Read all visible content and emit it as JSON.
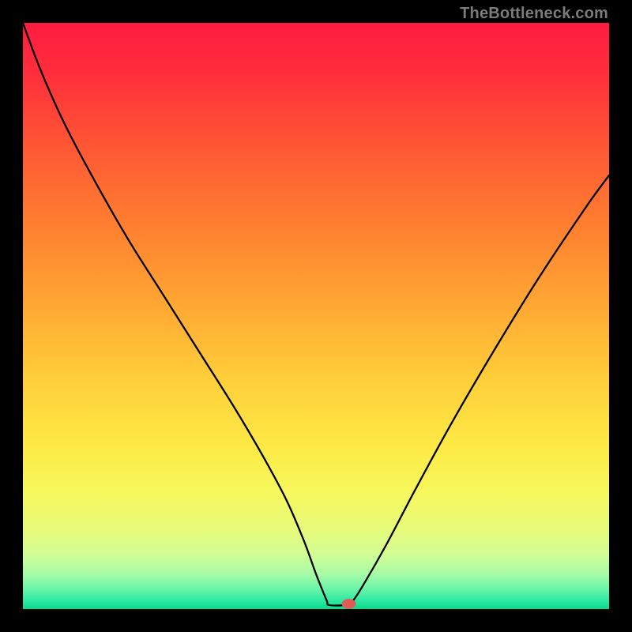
{
  "watermark": "TheBottleneck.com",
  "chart_data": {
    "type": "line",
    "title": "",
    "xlabel": "",
    "ylabel": "",
    "xlim": [
      0,
      100
    ],
    "ylim": [
      0,
      100
    ],
    "grid": false,
    "legend": false,
    "gradient_stops": [
      {
        "offset": 0.0,
        "color": "#ff1b3f"
      },
      {
        "offset": 0.09,
        "color": "#ff2f3b"
      },
      {
        "offset": 0.22,
        "color": "#ff5a33"
      },
      {
        "offset": 0.35,
        "color": "#ff8030"
      },
      {
        "offset": 0.48,
        "color": "#ffa733"
      },
      {
        "offset": 0.61,
        "color": "#ffcf3a"
      },
      {
        "offset": 0.72,
        "color": "#fee944"
      },
      {
        "offset": 0.8,
        "color": "#f6f85c"
      },
      {
        "offset": 0.86,
        "color": "#e9fb78"
      },
      {
        "offset": 0.905,
        "color": "#d3fd94"
      },
      {
        "offset": 0.94,
        "color": "#a7fba6"
      },
      {
        "offset": 0.965,
        "color": "#6cf5a9"
      },
      {
        "offset": 0.985,
        "color": "#2fe9a1"
      },
      {
        "offset": 1.0,
        "color": "#09d98d"
      }
    ],
    "series": [
      {
        "name": "bottleneck-curve",
        "x": [
          0.0,
          3.0,
          7.0,
          12.0,
          18.0,
          24.0,
          30.0,
          36.0,
          41.0,
          45.0,
          48.0,
          50.0,
          51.8,
          52.2,
          55.0,
          56.2,
          58.0,
          62.0,
          67.0,
          73.0,
          80.0,
          88.0,
          96.0,
          100.0
        ],
        "y": [
          100.0,
          92.0,
          83.0,
          73.5,
          63.0,
          53.5,
          44.0,
          34.5,
          26.0,
          18.5,
          11.5,
          6.0,
          1.5,
          0.7,
          0.7,
          1.3,
          4.0,
          11.0,
          20.5,
          31.5,
          43.5,
          56.5,
          68.5,
          74.0
        ]
      }
    ],
    "marker": {
      "x": 55.6,
      "y": 0.9,
      "color": "#e15a56",
      "rx": 1.2,
      "ry": 0.85
    }
  }
}
